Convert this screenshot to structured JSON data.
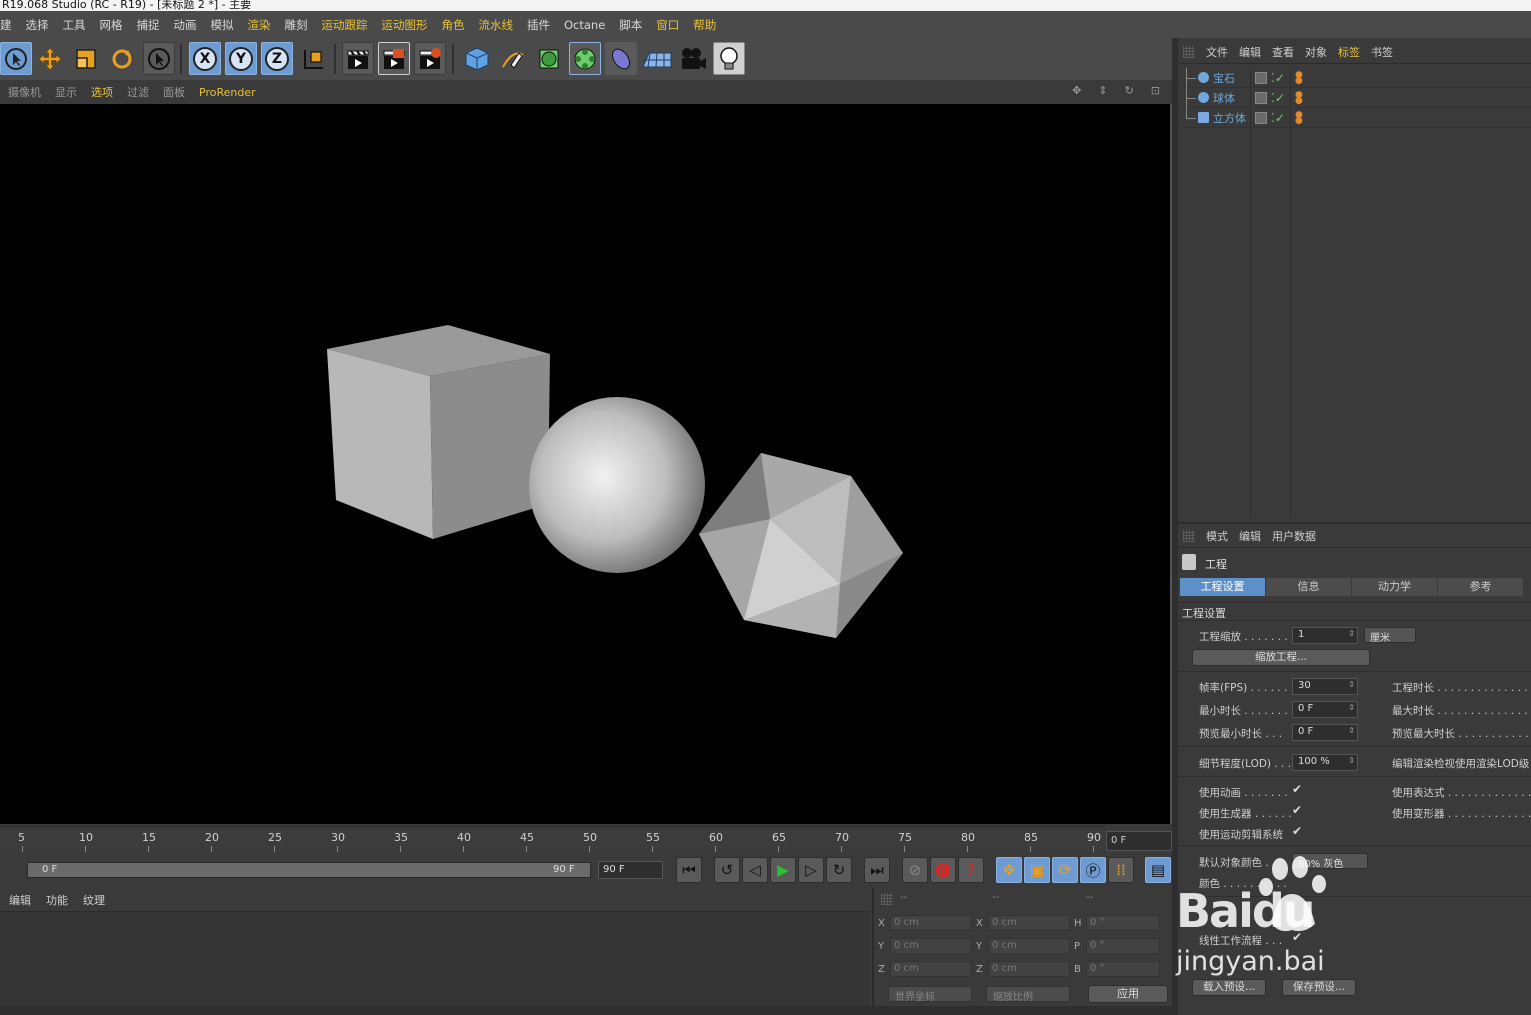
{
  "title": "R19.068 Studio (RC - R19) - [未标题 2 *] - 主要",
  "menu": [
    "建",
    "选择",
    "工具",
    "网格",
    "捕捉",
    "动画",
    "模拟",
    "渲染",
    "雕刻",
    "运动跟踪",
    "运动图形",
    "角色",
    "流水线",
    "插件",
    "Octane",
    "脚本",
    "窗口",
    "帮助"
  ],
  "viewport_menu": [
    "摄像机",
    "显示",
    "选项",
    "过滤",
    "面板",
    "ProRender"
  ],
  "toolbar": {
    "x_label": "X",
    "y_label": "Y",
    "z_label": "Z"
  },
  "timeline": {
    "ticks": [
      "5",
      "10",
      "15",
      "20",
      "25",
      "30",
      "35",
      "40",
      "45",
      "50",
      "55",
      "60",
      "65",
      "70",
      "75",
      "80",
      "85",
      "90"
    ],
    "current_frame": "0 F",
    "range_start": "0 F",
    "range_end": "90 F",
    "end_field": "90 F"
  },
  "material_menu": [
    "编辑",
    "功能",
    "纹理"
  ],
  "coords": {
    "headers": [
      "--",
      "--",
      "--"
    ],
    "rows": [
      {
        "a": "X",
        "av": "0 cm",
        "b": "X",
        "bv": "0 cm",
        "c": "H",
        "cv": "0 °"
      },
      {
        "a": "Y",
        "av": "0 cm",
        "b": "Y",
        "bv": "0 cm",
        "c": "P",
        "cv": "0 °"
      },
      {
        "a": "Z",
        "av": "0 cm",
        "b": "Z",
        "bv": "0 cm",
        "c": "B",
        "cv": "0 °"
      }
    ],
    "world": "世界坐标",
    "scale": "缩放比例",
    "apply": "应用"
  },
  "object_manager": {
    "menu": [
      "文件",
      "编辑",
      "查看",
      "对象",
      "标签",
      "书签"
    ],
    "objects": [
      {
        "name": "宝石",
        "icon": "gem-icon"
      },
      {
        "name": "球体",
        "icon": "sphere-icon"
      },
      {
        "name": "立方体",
        "icon": "cube-icon"
      }
    ]
  },
  "attributes": {
    "menu": [
      "模式",
      "编辑",
      "用户数据"
    ],
    "header": "工程",
    "tabs": [
      "工程设置",
      "信息",
      "动力学",
      "参考"
    ],
    "section": "工程设置",
    "project_scale_label": "工程缩放 . . . . . . .",
    "project_scale_value": "1",
    "project_scale_unit": "厘米",
    "scale_project_button": "缩放工程...",
    "fps_label": "帧率(FPS) . . . . . .",
    "fps_value": "30",
    "project_time_label": "工程时长 . . . . . . . . . . . . . .",
    "min_time_label": "最小时长 . . . . . . .",
    "min_time_value": "0 F",
    "max_time_label": "最大时长 . . . . . . . . . . . . . .",
    "preview_min_label": "预览最小时长 . . .",
    "preview_min_value": "0 F",
    "preview_max_label": "预览最大时长 . . . . . . . . . . .",
    "lod_label": "细节程度(LOD) . . .",
    "lod_value": "100 %",
    "lod_render_label": "编辑渲染检视使用渲染LOD级",
    "use_animation_label": "使用动画 . . . . . . .",
    "use_expression_label": "使用表达式 . . . . . . . . . . . . .",
    "use_generator_label": "使用生成器 . . . . . .",
    "use_deformer_label": "使用变形器 . . . . . . . . . . . . .",
    "use_motion_label": "使用运动剪辑系统",
    "default_color_label": "默认对象颜色 . . .",
    "default_color_value": "80% 灰色",
    "color_label": "颜色 . . . . . . . . . .",
    "linear_workflow_label": "线性工作流程 . . .",
    "load_preset_button": "载入预设...",
    "save_preset_button": "保存预设..."
  },
  "watermark": {
    "brand": "Baidu",
    "sub": "jingyan.bai"
  }
}
